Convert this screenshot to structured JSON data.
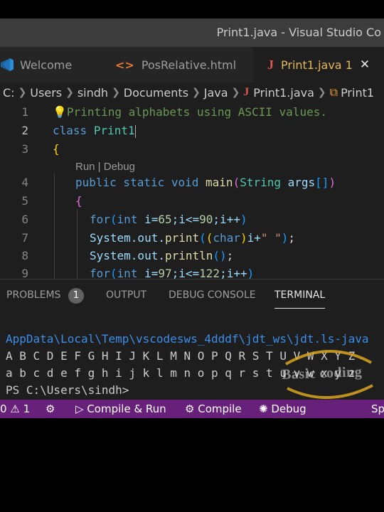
{
  "window": {
    "title": "Print1.java - Visual Studio Co"
  },
  "tabs": [
    {
      "label": "Welcome",
      "icon": "vscode-logo-icon"
    },
    {
      "label": "PosRelative.html",
      "icon": "html-code-icon"
    },
    {
      "label": "Print1.java 1",
      "icon": "java-icon",
      "close": "✕"
    }
  ],
  "breadcrumb": {
    "items": [
      "C:",
      "Users",
      "sindh",
      "Documents",
      "Java"
    ],
    "file": "Print1.java",
    "symbol": "Print1"
  },
  "editor": {
    "line_numbers": [
      "1",
      "2",
      "3",
      "4",
      "5",
      "6",
      "7",
      "8",
      "9"
    ],
    "codelens": "Run | Debug",
    "comment": "Printing alphabets using ASCII values.",
    "class_decl": {
      "keyword": "class",
      "name": "Print1"
    },
    "open_brace": "{",
    "main_decl": {
      "mods": "public static void",
      "fn": "main",
      "type": "String",
      "param": "args",
      "bracket": "[]"
    },
    "for1": {
      "kw": "for",
      "type": "int",
      "init": " i=",
      "start": "65",
      "cond": ";i<=",
      "end": "90",
      "inc": ";i++"
    },
    "print1": {
      "obj": "System.out.",
      "fn": "print",
      "cast": "char",
      "rest": "i+",
      "str": "\" \""
    },
    "print2": {
      "obj": "System.out.",
      "fn": "println"
    },
    "for2": {
      "kw": "for",
      "type": "int",
      "init": " i=",
      "start": "97",
      "cond": ";i<=",
      "end": "122",
      "inc": ";i++"
    }
  },
  "panel": {
    "tabs": [
      "PROBLEMS",
      "OUTPUT",
      "DEBUG CONSOLE",
      "TERMINAL"
    ],
    "problems_count": "1",
    "active_tab": "TERMINAL"
  },
  "terminal": {
    "lines": [
      "AppData\\Local\\Temp\\vscodesws_4dddf\\jdt_ws\\jdt.ls-java",
      "A B C D E F G H I J K L M N O P Q R S T U V W X Y Z",
      "a b c d e f g h i j k l m n o p q r s t u v w x y z",
      "PS C:\\Users\\sindh>"
    ]
  },
  "statusbar": {
    "errors": "0",
    "warnings": "1",
    "compile_run": "Compile & Run",
    "compile": "Compile",
    "debug": "Debug",
    "right": "Sp"
  },
  "watermark": "Basic coding",
  "colors": {
    "statusbar": "#68217a",
    "accent_tab": "#e2b95c",
    "editor_bg": "#1e1e1e"
  }
}
